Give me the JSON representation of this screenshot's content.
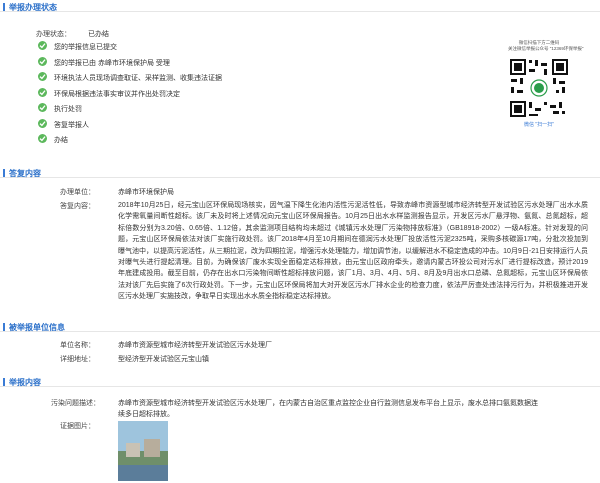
{
  "status_section": {
    "title": "举报办理状态",
    "state_label": "办理状态：",
    "state_value": "已办结",
    "steps": [
      {
        "text": "您的举报信息已提交"
      },
      {
        "text": "您的举报已由 赤峰市环境保护局 受理"
      },
      {
        "text": "环境执法人员现场调查取证、采样监测、收集违法证据"
      },
      {
        "text": "环保局根据违法事实审议并作出处罚决定"
      },
      {
        "text": "执行处罚"
      },
      {
        "text": "答复举报人"
      },
      {
        "text": "办结"
      }
    ]
  },
  "qr": {
    "caption_line1": "微信扫描下方二维码",
    "caption_line2": "关注微信举报公众号 \"12369环保举报\"",
    "footer": "微信 \"扫一扫\"",
    "icon": "qr-code-icon"
  },
  "reply_section": {
    "title": "答复内容",
    "unit_label": "办理单位：",
    "unit_value": "赤峰市环境保护局",
    "content_label": "答复内容：",
    "content_text": "2018年10月25日，经元宝山区环保局现场核实，因气温下降生化池内活性污泥活性低，导致赤峰市资源型城市经济转型开发试验区污水处理厂出水水质化学需氧量间断性超标。该厂未及时将上述情况向元宝山区环保局报告。10月25日出水水样监测报告显示，开发区污水厂悬浮物、氨氮、总氮超标，超标倍数分别为3.20倍、0.65倍、1.12倍，其余监测项目结构均未超过《城镇污水处理厂污染物排放标准》（GB18918-2002）一级A标准。针对发现的问题，元宝山区环保局依法对该厂实施行政处罚。该厂2018年4月至10月期间在德润污水处理厂投放活性污泥2325吨，采购多核碳源17吨，分批次投加到曝气池中，以提高污泥活性，从三期拉泥，改为四期拉泥，增强污水处理能力，增加调节池，以缓解进水不稳定造成的冲击。10月9日-21日安排运行人员对曝气头进行提起清理。目前，为确保该厂废水实现全面稳定达标排放，由元宝山区政府牵头，邀请内蒙古环投公司对污水厂进行提标改造，预计2019年底建成投用。截至目前，仍存在出水口污染物间断性超标排放问题，该厂1月、3月、4月、5月、8月及9月出水口总磷、总氮超标，元宝山区环保局依法对该厂先后实施了6次行政处罚。下一步，元宝山区环保局将加大对开发区污水厂排水企业的检查力度，依法严厉查处违法排污行为，并积极推进开发区污水处理厂实施技改，争取早日实现出水水质全指标稳定达标排放。"
  },
  "unit_section": {
    "title": "被举报单位信息",
    "name_label": "单位名称：",
    "name_value": "赤峰市资源型城市经济转型开发试验区污水处理厂",
    "address_label": "详细地址：",
    "address_value": "型经济型开发试验区元宝山镇"
  },
  "report_section": {
    "title": "举报内容",
    "issue_label": "污染问题描述：",
    "issue_line1": "赤峰市资源型城市经济转型开发试验区污水处理厂，在内蒙古自治区重点监控企业自行监测信息发布平台上显示，废水总排口氨氮数据连",
    "issue_line2": "续多日超标排放。",
    "photo_label": "证据图片："
  },
  "colors": {
    "accent": "#2a6fc9",
    "check": "#5cb85c"
  }
}
